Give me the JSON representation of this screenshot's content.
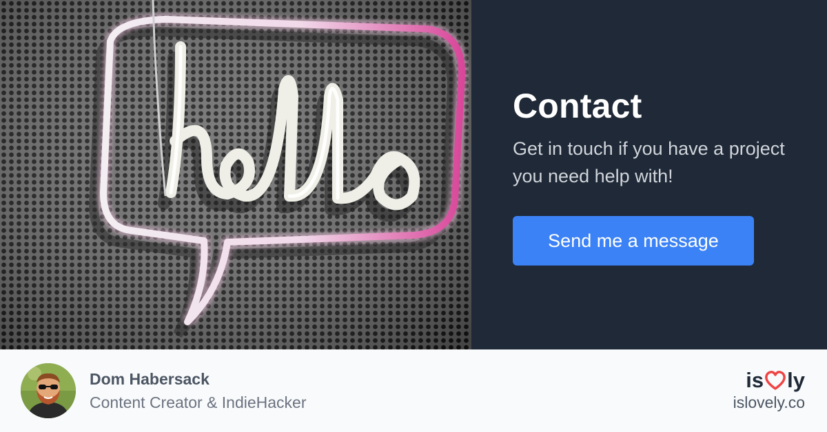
{
  "hero": {
    "title": "Contact",
    "subtitle": "Get in touch if you have a project you need help with!",
    "cta_label": "Send me a message",
    "neon_text": "hello"
  },
  "footer": {
    "author_name": "Dom Habersack",
    "author_role": "Content Creator & IndieHacker",
    "brand_left": "is",
    "brand_right": "ly",
    "brand_domain": "islovely.co"
  },
  "colors": {
    "panel_bg": "#1f2937",
    "cta_bg": "#3b82f6",
    "footer_bg": "#f9fafb",
    "heart": "#ef4444"
  },
  "icons": {
    "brand_heart": "heart-icon"
  }
}
